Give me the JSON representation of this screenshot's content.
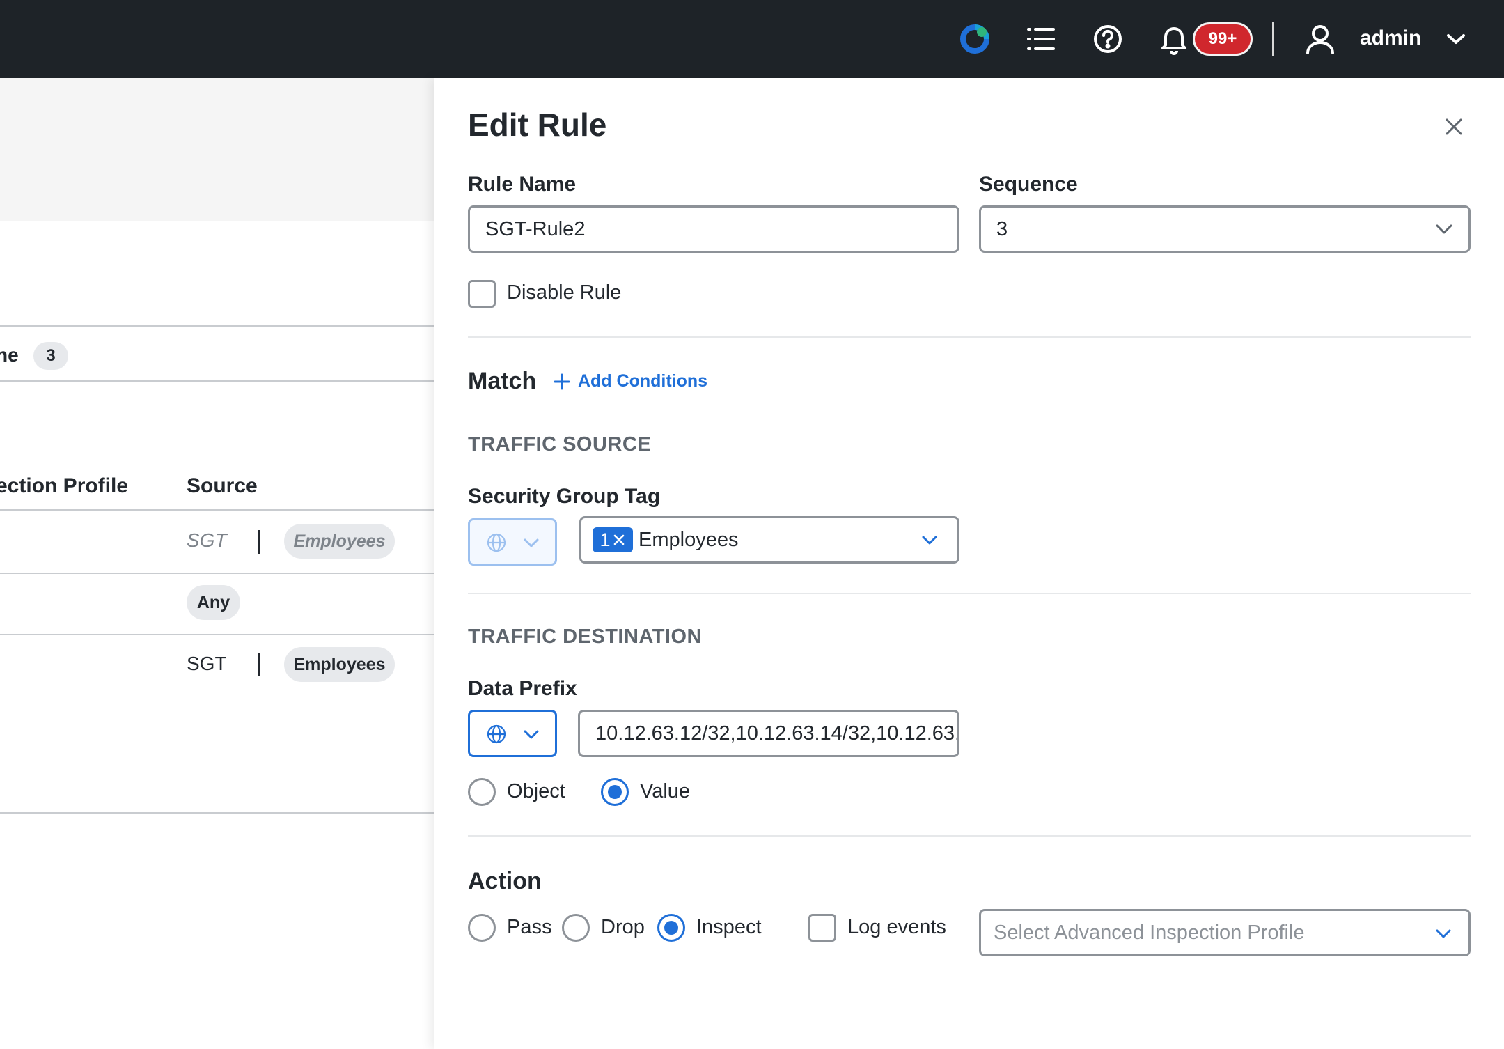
{
  "topbar": {
    "notification_count": "99+",
    "user_name": "admin"
  },
  "background": {
    "tab_label": "ne",
    "tab_count": "3",
    "columns": [
      "ection Profile",
      "Source"
    ],
    "rows": [
      {
        "source_type": "SGT",
        "source_value": "Employees",
        "style": "italic-muted"
      },
      {
        "source_value": "Any"
      },
      {
        "source_type": "SGT",
        "source_value": "Employees",
        "style": "normal"
      }
    ]
  },
  "panel": {
    "title": "Edit Rule",
    "rule_name_label": "Rule Name",
    "rule_name_value": "SGT-Rule2",
    "sequence_label": "Sequence",
    "sequence_value": "3",
    "disable_rule_label": "Disable Rule",
    "match_heading": "Match",
    "add_conditions_label": "Add Conditions",
    "traffic_source_caption": "TRAFFIC SOURCE",
    "sgt_label": "Security Group Tag",
    "sgt_tag_count": "1",
    "sgt_selected": "Employees",
    "traffic_destination_caption": "TRAFFIC DESTINATION",
    "data_prefix_label": "Data Prefix",
    "data_prefix_value": "10.12.63.12/32,10.12.63.14/32,10.12.63.",
    "object_label": "Object",
    "value_label": "Value",
    "action_heading": "Action",
    "pass_label": "Pass",
    "drop_label": "Drop",
    "inspect_label": "Inspect",
    "log_events_label": "Log events",
    "inspection_profile_placeholder": "Select Advanced Inspection Profile",
    "selected_action": "Inspect",
    "selected_prefix_mode": "Value"
  },
  "colors": {
    "accent": "#1f6fd8",
    "topbar": "#1e2328",
    "badge": "#d0272d"
  }
}
